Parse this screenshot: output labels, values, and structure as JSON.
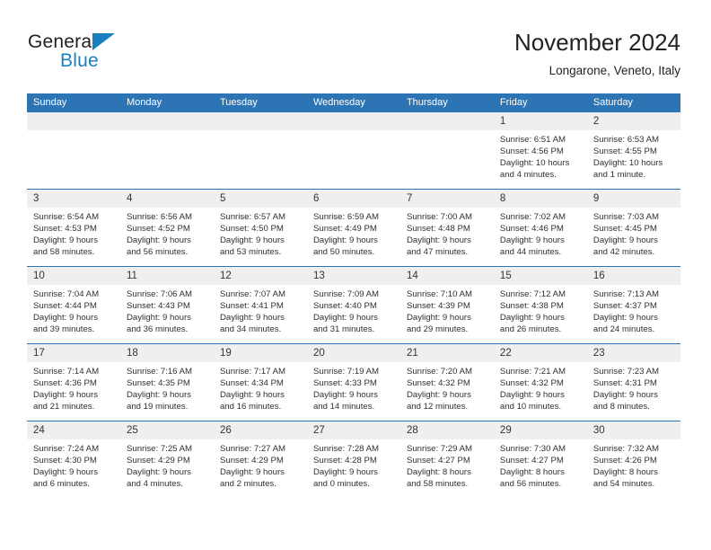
{
  "logo": {
    "word_one": "General",
    "word_two": "Blue",
    "icon": "triangle-logo-mark"
  },
  "header": {
    "title": "November 2024",
    "subtitle": "Longarone, Veneto, Italy"
  },
  "calendar": {
    "day_headers": [
      "Sunday",
      "Monday",
      "Tuesday",
      "Wednesday",
      "Thursday",
      "Friday",
      "Saturday"
    ],
    "colors": {
      "header_blue": "#2d74b5",
      "daynum_gray": "#efefef",
      "logo_blue": "#1a7fc1"
    },
    "weeks": [
      [
        {
          "day": "",
          "lines": []
        },
        {
          "day": "",
          "lines": []
        },
        {
          "day": "",
          "lines": []
        },
        {
          "day": "",
          "lines": []
        },
        {
          "day": "",
          "lines": []
        },
        {
          "day": "1",
          "lines": [
            "Sunrise: 6:51 AM",
            "Sunset: 4:56 PM",
            "Daylight: 10 hours and 4 minutes."
          ]
        },
        {
          "day": "2",
          "lines": [
            "Sunrise: 6:53 AM",
            "Sunset: 4:55 PM",
            "Daylight: 10 hours and 1 minute."
          ]
        }
      ],
      [
        {
          "day": "3",
          "lines": [
            "Sunrise: 6:54 AM",
            "Sunset: 4:53 PM",
            "Daylight: 9 hours and 58 minutes."
          ]
        },
        {
          "day": "4",
          "lines": [
            "Sunrise: 6:56 AM",
            "Sunset: 4:52 PM",
            "Daylight: 9 hours and 56 minutes."
          ]
        },
        {
          "day": "5",
          "lines": [
            "Sunrise: 6:57 AM",
            "Sunset: 4:50 PM",
            "Daylight: 9 hours and 53 minutes."
          ]
        },
        {
          "day": "6",
          "lines": [
            "Sunrise: 6:59 AM",
            "Sunset: 4:49 PM",
            "Daylight: 9 hours and 50 minutes."
          ]
        },
        {
          "day": "7",
          "lines": [
            "Sunrise: 7:00 AM",
            "Sunset: 4:48 PM",
            "Daylight: 9 hours and 47 minutes."
          ]
        },
        {
          "day": "8",
          "lines": [
            "Sunrise: 7:02 AM",
            "Sunset: 4:46 PM",
            "Daylight: 9 hours and 44 minutes."
          ]
        },
        {
          "day": "9",
          "lines": [
            "Sunrise: 7:03 AM",
            "Sunset: 4:45 PM",
            "Daylight: 9 hours and 42 minutes."
          ]
        }
      ],
      [
        {
          "day": "10",
          "lines": [
            "Sunrise: 7:04 AM",
            "Sunset: 4:44 PM",
            "Daylight: 9 hours and 39 minutes."
          ]
        },
        {
          "day": "11",
          "lines": [
            "Sunrise: 7:06 AM",
            "Sunset: 4:43 PM",
            "Daylight: 9 hours and 36 minutes."
          ]
        },
        {
          "day": "12",
          "lines": [
            "Sunrise: 7:07 AM",
            "Sunset: 4:41 PM",
            "Daylight: 9 hours and 34 minutes."
          ]
        },
        {
          "day": "13",
          "lines": [
            "Sunrise: 7:09 AM",
            "Sunset: 4:40 PM",
            "Daylight: 9 hours and 31 minutes."
          ]
        },
        {
          "day": "14",
          "lines": [
            "Sunrise: 7:10 AM",
            "Sunset: 4:39 PM",
            "Daylight: 9 hours and 29 minutes."
          ]
        },
        {
          "day": "15",
          "lines": [
            "Sunrise: 7:12 AM",
            "Sunset: 4:38 PM",
            "Daylight: 9 hours and 26 minutes."
          ]
        },
        {
          "day": "16",
          "lines": [
            "Sunrise: 7:13 AM",
            "Sunset: 4:37 PM",
            "Daylight: 9 hours and 24 minutes."
          ]
        }
      ],
      [
        {
          "day": "17",
          "lines": [
            "Sunrise: 7:14 AM",
            "Sunset: 4:36 PM",
            "Daylight: 9 hours and 21 minutes."
          ]
        },
        {
          "day": "18",
          "lines": [
            "Sunrise: 7:16 AM",
            "Sunset: 4:35 PM",
            "Daylight: 9 hours and 19 minutes."
          ]
        },
        {
          "day": "19",
          "lines": [
            "Sunrise: 7:17 AM",
            "Sunset: 4:34 PM",
            "Daylight: 9 hours and 16 minutes."
          ]
        },
        {
          "day": "20",
          "lines": [
            "Sunrise: 7:19 AM",
            "Sunset: 4:33 PM",
            "Daylight: 9 hours and 14 minutes."
          ]
        },
        {
          "day": "21",
          "lines": [
            "Sunrise: 7:20 AM",
            "Sunset: 4:32 PM",
            "Daylight: 9 hours and 12 minutes."
          ]
        },
        {
          "day": "22",
          "lines": [
            "Sunrise: 7:21 AM",
            "Sunset: 4:32 PM",
            "Daylight: 9 hours and 10 minutes."
          ]
        },
        {
          "day": "23",
          "lines": [
            "Sunrise: 7:23 AM",
            "Sunset: 4:31 PM",
            "Daylight: 9 hours and 8 minutes."
          ]
        }
      ],
      [
        {
          "day": "24",
          "lines": [
            "Sunrise: 7:24 AM",
            "Sunset: 4:30 PM",
            "Daylight: 9 hours and 6 minutes."
          ]
        },
        {
          "day": "25",
          "lines": [
            "Sunrise: 7:25 AM",
            "Sunset: 4:29 PM",
            "Daylight: 9 hours and 4 minutes."
          ]
        },
        {
          "day": "26",
          "lines": [
            "Sunrise: 7:27 AM",
            "Sunset: 4:29 PM",
            "Daylight: 9 hours and 2 minutes."
          ]
        },
        {
          "day": "27",
          "lines": [
            "Sunrise: 7:28 AM",
            "Sunset: 4:28 PM",
            "Daylight: 9 hours and 0 minutes."
          ]
        },
        {
          "day": "28",
          "lines": [
            "Sunrise: 7:29 AM",
            "Sunset: 4:27 PM",
            "Daylight: 8 hours and 58 minutes."
          ]
        },
        {
          "day": "29",
          "lines": [
            "Sunrise: 7:30 AM",
            "Sunset: 4:27 PM",
            "Daylight: 8 hours and 56 minutes."
          ]
        },
        {
          "day": "30",
          "lines": [
            "Sunrise: 7:32 AM",
            "Sunset: 4:26 PM",
            "Daylight: 8 hours and 54 minutes."
          ]
        }
      ]
    ]
  }
}
